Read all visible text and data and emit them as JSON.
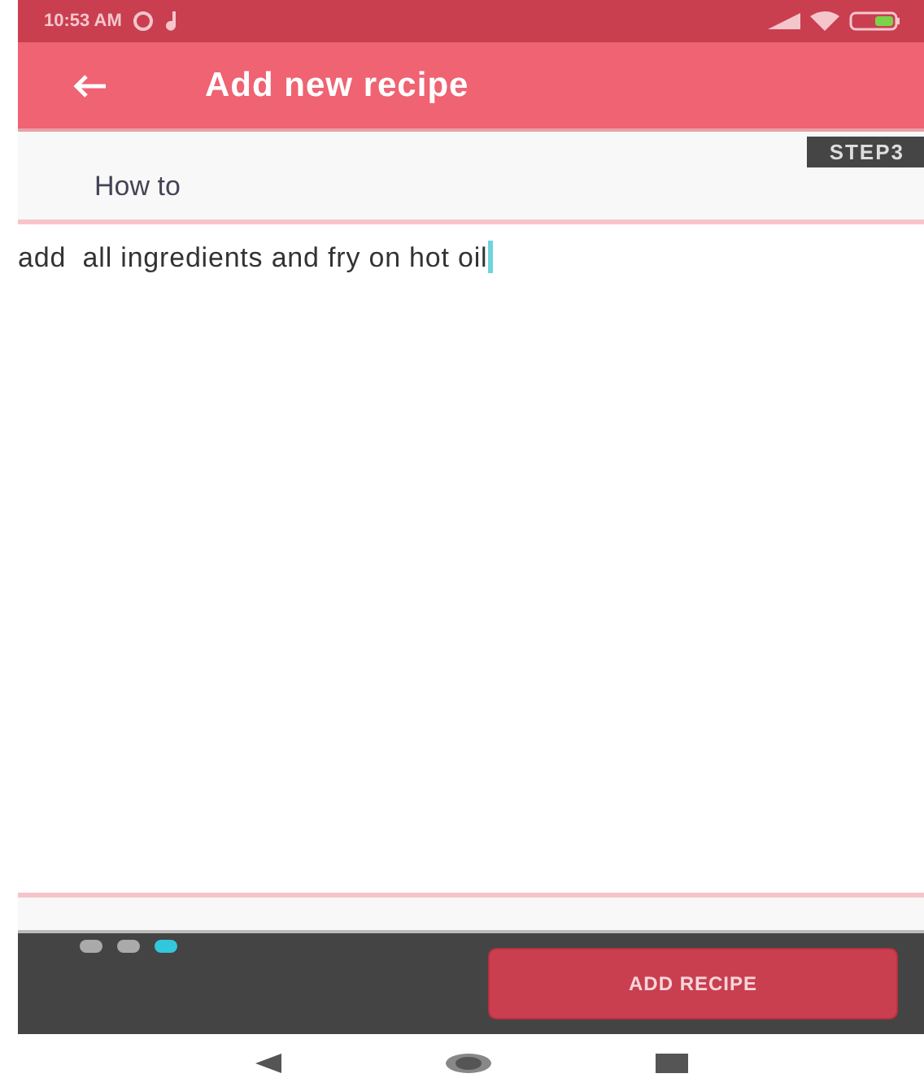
{
  "status_bar": {
    "time": "10:53 AM"
  },
  "toolbar": {
    "title": "Add new recipe"
  },
  "step_badge": "STEP3",
  "field": {
    "label": "How to",
    "value": "add  all ingredients and fry on hot oil"
  },
  "pager": [
    {
      "selected": false
    },
    {
      "selected": false
    },
    {
      "selected": true
    }
  ],
  "button": "ADD RECIPE"
}
